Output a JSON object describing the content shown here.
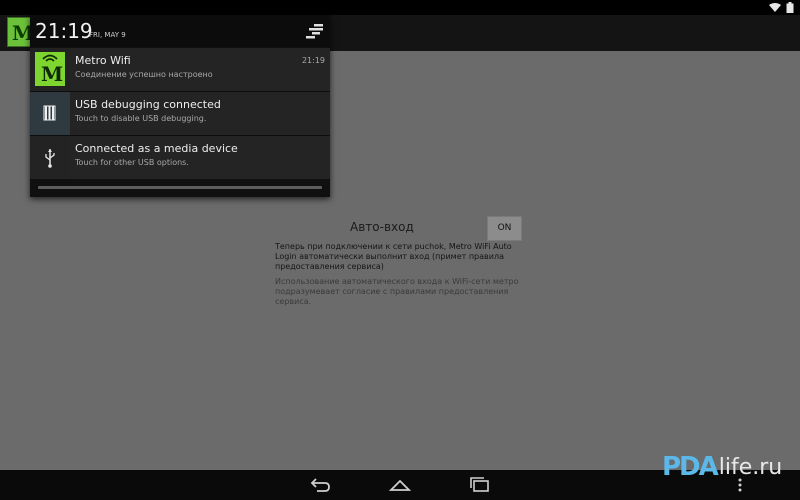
{
  "status_bar": {
    "icons": [
      "wifi-icon",
      "battery-icon"
    ]
  },
  "app": {
    "logo_letter": "M",
    "auto_login_label": "Авто-вход",
    "toggle_label": "ON",
    "description_primary": "Теперь при подключении к сети puchok, Metro WiFi Auto Login автоматически выполнит вход (примет правила предоставления сервиса)",
    "description_secondary": "Использование автоматического входа к WiFi-сети метро подразумевает согласие с правилами предоставления сервиса."
  },
  "shade": {
    "time": "21:19",
    "date": "FRI, MAY 9",
    "notifications": [
      {
        "icon": "metro-wifi-logo",
        "title": "Metro Wifi",
        "subtitle": "Соединение успешно настроено",
        "time": "21:19"
      },
      {
        "icon": "usb-debugging-icon",
        "title": "USB debugging connected",
        "subtitle": "Touch to disable USB debugging."
      },
      {
        "icon": "usb-icon",
        "title": "Connected as a media device",
        "subtitle": "Touch for other USB options."
      }
    ]
  },
  "nav_bar": {
    "buttons": [
      "back-icon",
      "home-icon",
      "recent-apps-icon",
      "menu-icon"
    ]
  },
  "watermark": {
    "logo": "PDA",
    "text": "life.ru"
  },
  "colors": {
    "metro_green": "#7fd52f",
    "watermark_blue": "#5bb8e8",
    "shade_bg": "#101010",
    "notification_bg": "#242424"
  }
}
